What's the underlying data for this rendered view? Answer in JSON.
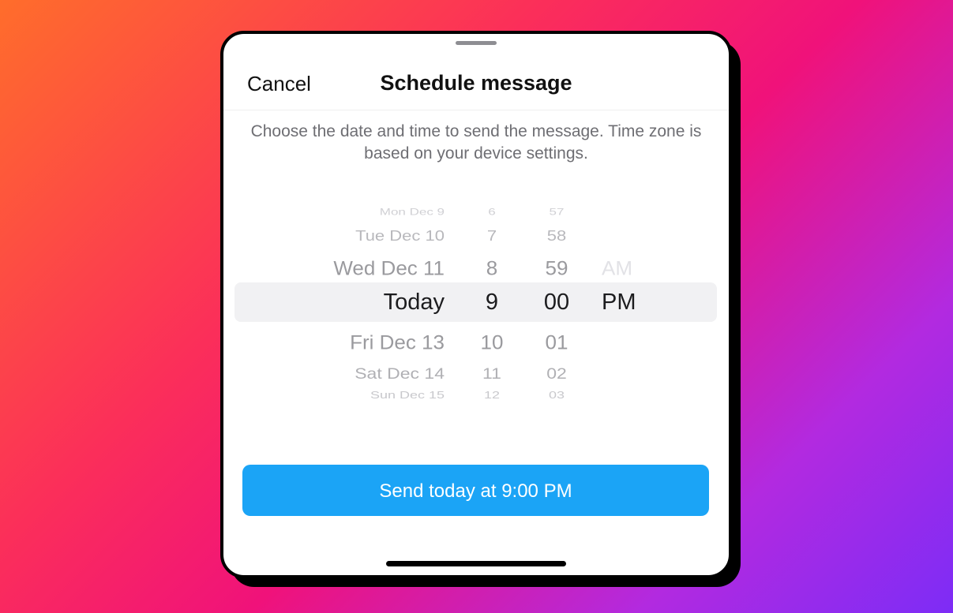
{
  "header": {
    "cancel_label": "Cancel",
    "title": "Schedule message"
  },
  "description": "Choose the date and time to send the message. Time zone is based on your device settings.",
  "picker": {
    "rows": [
      {
        "date": "Mon Dec 9",
        "hour": "6",
        "minute": "57",
        "ampm": ""
      },
      {
        "date": "Tue Dec 10",
        "hour": "7",
        "minute": "58",
        "ampm": ""
      },
      {
        "date": "Wed Dec 11",
        "hour": "8",
        "minute": "59",
        "ampm": "AM"
      },
      {
        "date": "Today",
        "hour": "9",
        "minute": "00",
        "ampm": "PM"
      },
      {
        "date": "Fri Dec 13",
        "hour": "10",
        "minute": "01",
        "ampm": ""
      },
      {
        "date": "Sat Dec 14",
        "hour": "11",
        "minute": "02",
        "ampm": ""
      },
      {
        "date": "Sun Dec 15",
        "hour": "12",
        "minute": "03",
        "ampm": ""
      }
    ],
    "selected": {
      "date": "Today",
      "hour": "9",
      "minute": "00",
      "ampm": "PM"
    }
  },
  "send_button": {
    "label": "Send today at 9:00 PM"
  },
  "colors": {
    "accent": "#1ba4f6",
    "background_gradient": [
      "#ff6d2b",
      "#f0127a",
      "#7d2cf6"
    ]
  }
}
